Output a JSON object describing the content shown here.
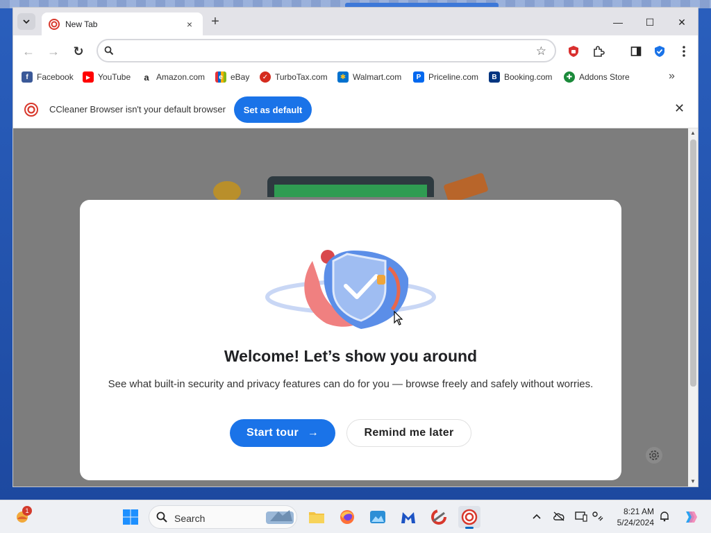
{
  "window": {
    "tab_title": "New Tab",
    "tab_close": "×",
    "new_tab": "+",
    "minimize": "—",
    "maximize": "☐",
    "close": "✕"
  },
  "toolbar": {
    "back": "←",
    "forward": "→",
    "reload": "↻",
    "address_value": "",
    "address_placeholder": "",
    "bookmark_star": "☆"
  },
  "bookmarks": [
    {
      "label": "Facebook",
      "icon": "facebook-icon",
      "color": "#3b5998",
      "glyph": "f"
    },
    {
      "label": "YouTube",
      "icon": "youtube-icon",
      "color": "#ff0000",
      "glyph": "▶"
    },
    {
      "label": "Amazon.com",
      "icon": "amazon-icon",
      "color": "#222222",
      "glyph": "a"
    },
    {
      "label": "eBay",
      "icon": "ebay-icon",
      "color": "#e53238",
      "glyph": "e"
    },
    {
      "label": "TurboTax.com",
      "icon": "turbotax-icon",
      "color": "#d52b1e",
      "glyph": "✓"
    },
    {
      "label": "Walmart.com",
      "icon": "walmart-icon",
      "color": "#0071ce",
      "glyph": "✱"
    },
    {
      "label": "Priceline.com",
      "icon": "priceline-icon",
      "color": "#0068ef",
      "glyph": "P"
    },
    {
      "label": "Booking.com",
      "icon": "booking-icon",
      "color": "#003580",
      "glyph": "B"
    },
    {
      "label": "Addons Store",
      "icon": "addons-store-icon",
      "color": "#1b8a3a",
      "glyph": "✚"
    }
  ],
  "bookmarks_more": "»",
  "infobar": {
    "message": "CCleaner Browser isn't your default browser",
    "button": "Set as default",
    "close": "✕"
  },
  "modal": {
    "title": "Welcome! Let’s show you around",
    "description": "See what built-in security and privacy features can do for you — browse freely and safely without worries.",
    "primary_button": "Start tour",
    "primary_arrow": "→",
    "secondary_button": "Remind me later"
  },
  "taskbar": {
    "search_label": "Search",
    "notification_badge": "1",
    "clock_time": "8:21 AM",
    "clock_date": "5/24/2024"
  },
  "colors": {
    "accent": "#1a73e8",
    "page_overlay": "#7d7d7d",
    "desktop": "#1f4fa8"
  }
}
